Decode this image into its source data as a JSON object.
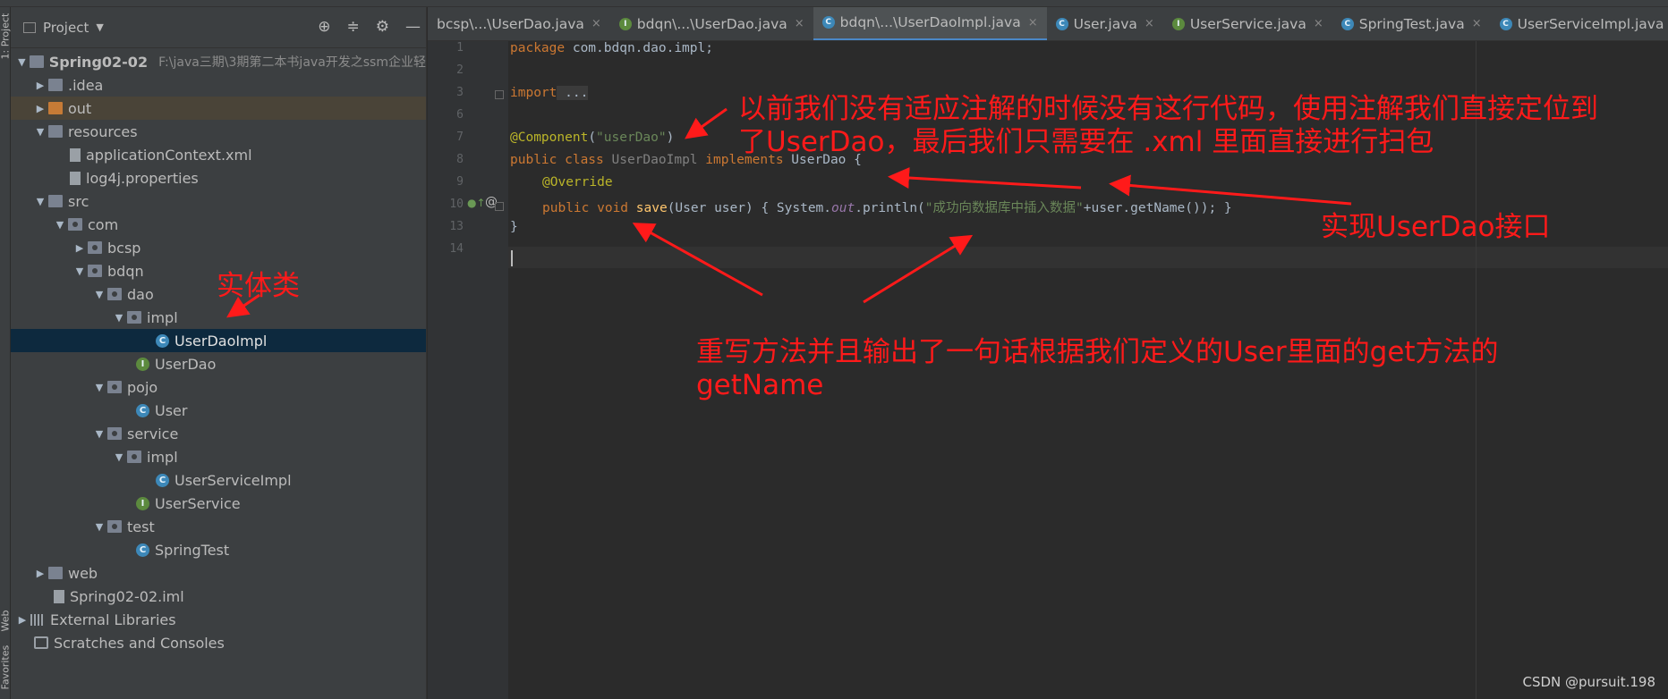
{
  "left_strip": {
    "project_label": "1: Project",
    "web_label": "Web",
    "favorites_label": "Favorites"
  },
  "project_panel": {
    "title": "Project",
    "icons": [
      "target-icon",
      "collapse-icon",
      "gear-icon",
      "minimize-icon"
    ],
    "tree": [
      {
        "label": "Spring02-02",
        "path": "F:\\java三期\\3期第二本书java开发之ssm企业轻",
        "icon": "module-folder-icon"
      },
      {
        "label": ".idea",
        "icon": "folder-icon"
      },
      {
        "label": "out",
        "icon": "folder-icon"
      },
      {
        "label": "resources",
        "icon": "folder-icon"
      },
      {
        "label": "applicationContext.xml",
        "icon": "xml-file-icon"
      },
      {
        "label": "log4j.properties",
        "icon": "properties-file-icon"
      },
      {
        "label": "src",
        "icon": "folder-icon"
      },
      {
        "label": "com",
        "icon": "package-icon"
      },
      {
        "label": "bcsp",
        "icon": "package-icon"
      },
      {
        "label": "bdqn",
        "icon": "package-icon"
      },
      {
        "label": "dao",
        "icon": "package-icon"
      },
      {
        "label": "impl",
        "icon": "package-icon"
      },
      {
        "label": "UserDaoImpl",
        "icon": "class-icon"
      },
      {
        "label": "UserDao",
        "icon": "interface-icon"
      },
      {
        "label": "pojo",
        "icon": "package-icon"
      },
      {
        "label": "User",
        "icon": "class-icon"
      },
      {
        "label": "service",
        "icon": "package-icon"
      },
      {
        "label": "impl",
        "icon": "package-icon"
      },
      {
        "label": "UserServiceImpl",
        "icon": "class-icon"
      },
      {
        "label": "UserService",
        "icon": "interface-icon"
      },
      {
        "label": "test",
        "icon": "package-icon"
      },
      {
        "label": "SpringTest",
        "icon": "class-icon"
      },
      {
        "label": "web",
        "icon": "folder-icon"
      },
      {
        "label": "Spring02-02.iml",
        "icon": "iml-file-icon"
      },
      {
        "label": "External Libraries",
        "icon": "library-icon"
      },
      {
        "label": "Scratches and Consoles",
        "icon": "scratches-icon"
      }
    ]
  },
  "tabs": [
    {
      "label": "bcsp\\...\\UserDao.java",
      "icon_letter": "I"
    },
    {
      "label": "bdqn\\...\\UserDao.java",
      "icon_letter": "I"
    },
    {
      "label": "bdqn\\...\\UserDaoImpl.java",
      "icon_letter": "C",
      "active": true
    },
    {
      "label": "User.java",
      "icon_letter": "C"
    },
    {
      "label": "UserService.java",
      "icon_letter": "I"
    },
    {
      "label": "SpringTest.java",
      "icon_letter": "C"
    },
    {
      "label": "UserServiceImpl.java",
      "icon_letter": "C"
    }
  ],
  "tab_close": "×",
  "tab_menu": "≡",
  "editor": {
    "line_numbers": [
      "1",
      "2",
      "3",
      "6",
      "7",
      "8",
      "9",
      "10",
      "13",
      "14"
    ],
    "code": {
      "l1_kw": "package",
      "l1_rest": " com.bdqn.dao.impl;",
      "l3_kw": "import",
      "l3_rest": " ...",
      "l7_ann": "@Component",
      "l7_open": "(",
      "l7_str": "\"userDao\"",
      "l7_close": ")",
      "l8_kw1": "public class",
      "l8_name": " UserDaoImpl ",
      "l8_kw2": "implements",
      "l8_rest": " UserDao {",
      "l9_ann": "@Override",
      "l10_kw": "public void",
      "l10_fn": " save",
      "l10_params": "(User user) { System.",
      "l10_out": "out",
      "l10_println": ".println(",
      "l10_str": "\"成功向数据库中插入数据\"",
      "l10_tail": "+user.getName()); }",
      "l13": "}"
    }
  },
  "annotations": {
    "top_line1": "以前我们没有适应注解的时候没有这行代码，使用注解我们直接定位到",
    "top_line2": "了UserDao，最后我们只需要在  .xml  里面直接进行扫包",
    "right": "实现UserDao接口",
    "entity": "实体类",
    "bottom_line1": "重写方法并且输出了一句话根据我们定义的User里面的get方法的",
    "bottom_line2": "getName"
  },
  "watermark": "CSDN @pursuit.198",
  "colors": {
    "annotation_red": "#ff1a1a",
    "selection": "#0d293e",
    "tab_accent": "#4a88c7"
  }
}
